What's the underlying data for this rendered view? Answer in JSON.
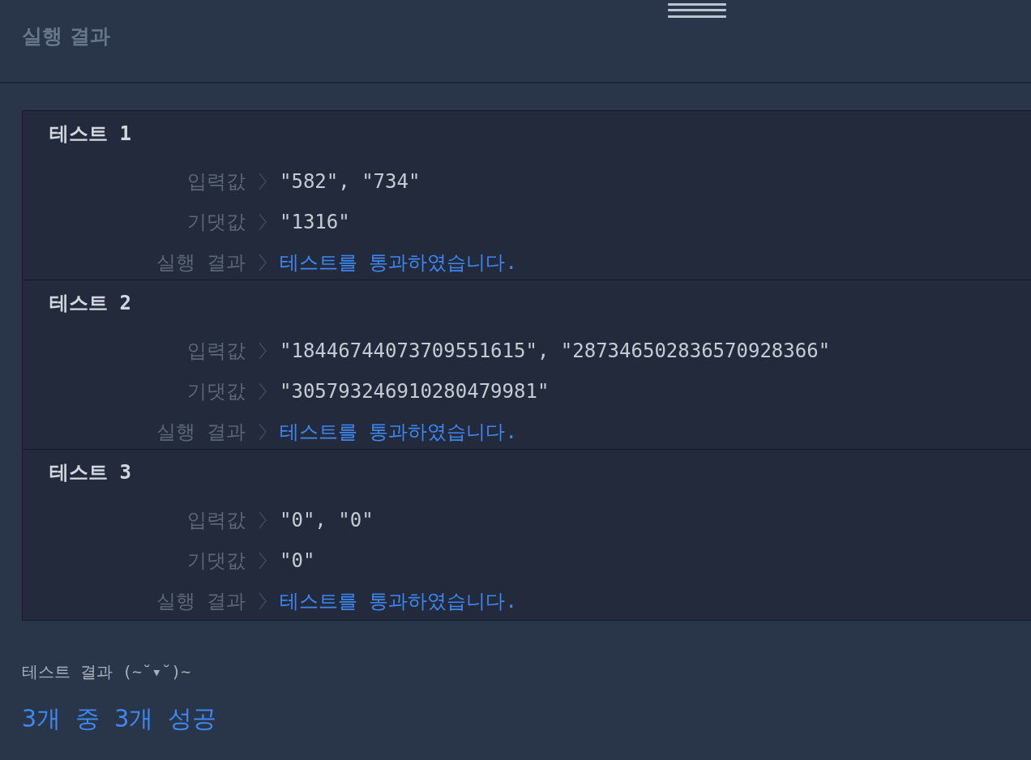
{
  "header": {
    "title": "실행 결과"
  },
  "tests": [
    {
      "title": "테스트 1",
      "rows": [
        {
          "kind": "plain",
          "label": "입력값",
          "value": "\"582\", \"734\""
        },
        {
          "kind": "plain",
          "label": "기댓값",
          "value": "\"1316\""
        },
        {
          "kind": "pass",
          "label": "실행 결과",
          "value": "테스트를 통과하였습니다."
        }
      ]
    },
    {
      "title": "테스트 2",
      "rows": [
        {
          "kind": "plain",
          "label": "입력값",
          "value": "\"18446744073709551615\", \"287346502836570928366\""
        },
        {
          "kind": "plain",
          "label": "기댓값",
          "value": "\"305793246910280479981\""
        },
        {
          "kind": "pass",
          "label": "실행 결과",
          "value": "테스트를 통과하였습니다."
        }
      ]
    },
    {
      "title": "테스트 3",
      "rows": [
        {
          "kind": "plain",
          "label": "입력값",
          "value": "\"0\", \"0\""
        },
        {
          "kind": "plain",
          "label": "기댓값",
          "value": "\"0\""
        },
        {
          "kind": "pass",
          "label": "실행 결과",
          "value": "테스트를 통과하였습니다."
        }
      ]
    }
  ],
  "summary": {
    "heading": "테스트 결과 (~˘▾˘)~",
    "result": "3개 중 3개 성공"
  }
}
